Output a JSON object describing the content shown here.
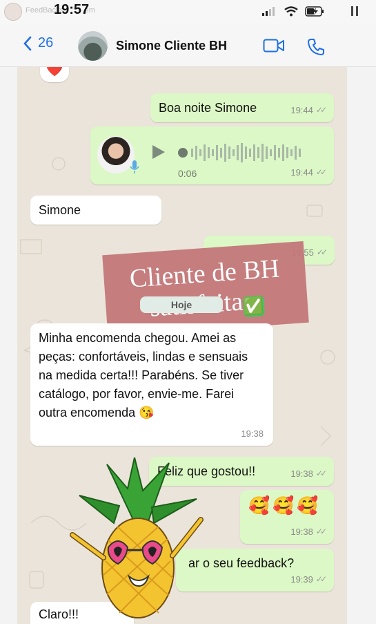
{
  "story": {
    "account": "FeedBacks",
    "account_suffix": "em",
    "time": "19:57"
  },
  "header": {
    "back_count": "26",
    "contact_name": "Simone Cliente BH"
  },
  "messages": {
    "heart": "❤️",
    "m1": {
      "text": "Boa noite Simone",
      "time": "19:44"
    },
    "audio": {
      "duration": "0:06",
      "time": "19:44"
    },
    "m2": {
      "text": "Simone"
    },
    "m3": {
      "time": "19:55"
    },
    "date_chip": "Hoje",
    "m4": {
      "text": "Minha encomenda chegou. Amei as peças: confortáveis,  lindas e sensuais na medida certa!!! Parabéns.  Se tiver catálogo,  por favor,  envie-me.  Farei outra encomenda 😘",
      "time": "19:38"
    },
    "m5": {
      "text": "Feliz que gostou!!",
      "time": "19:38"
    },
    "m6": {
      "text": "🥰🥰🥰",
      "time": "19:38"
    },
    "m7": {
      "text": "ar o seu feedback?",
      "time": "19:39"
    },
    "m8": {
      "text": "Claro!!!",
      "time": "19:39"
    }
  },
  "overlay": {
    "line1": "Cliente de BH",
    "line2": "satisfeita",
    "emoji": "✅"
  },
  "colors": {
    "incoming": "#ffffff",
    "outgoing": "#dcf8c6",
    "accent": "#1f6fe6",
    "overlay": "#c3787a"
  }
}
